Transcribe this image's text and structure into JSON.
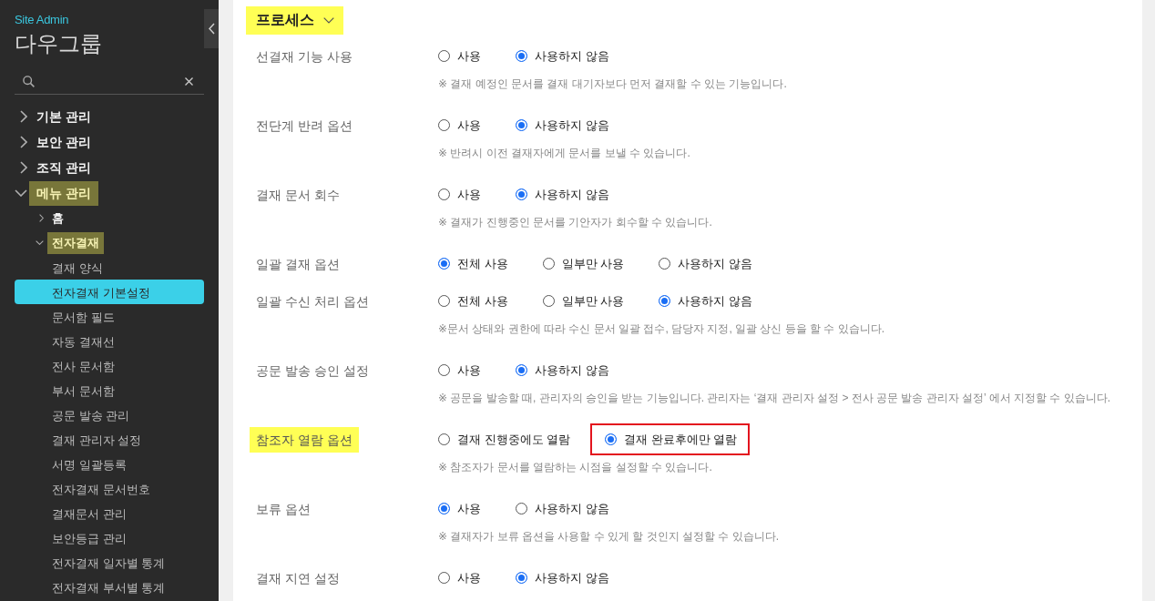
{
  "sidebar": {
    "subtitle": "Site Admin",
    "title": "다우그룹",
    "tree": [
      {
        "kind": "folder",
        "label": "기본 관리",
        "expanded": false,
        "highlighted": false,
        "selected": false
      },
      {
        "kind": "folder",
        "label": "보안 관리",
        "expanded": false,
        "highlighted": false,
        "selected": false
      },
      {
        "kind": "folder",
        "label": "조직 관리",
        "expanded": false,
        "highlighted": false,
        "selected": false
      },
      {
        "kind": "folder",
        "label": "메뉴 관리",
        "expanded": true,
        "highlighted": true,
        "selected": false,
        "children": [
          {
            "kind": "folder",
            "label": "홈",
            "expanded": false,
            "highlighted": false,
            "selected": false
          },
          {
            "kind": "folder",
            "label": "전자결재",
            "expanded": true,
            "highlighted": true,
            "selected": false,
            "children": [
              {
                "kind": "page",
                "label": "결재 양식",
                "highlighted": false,
                "selected": false
              },
              {
                "kind": "page",
                "label": "전자결재 기본설정",
                "highlighted": false,
                "selected": true
              },
              {
                "kind": "page",
                "label": "문서함 필드",
                "highlighted": false,
                "selected": false
              },
              {
                "kind": "page",
                "label": "자동 결재선",
                "highlighted": false,
                "selected": false
              },
              {
                "kind": "page",
                "label": "전사 문서함",
                "highlighted": false,
                "selected": false
              },
              {
                "kind": "page",
                "label": "부서 문서함",
                "highlighted": false,
                "selected": false
              },
              {
                "kind": "page",
                "label": "공문 발송 관리",
                "highlighted": false,
                "selected": false
              },
              {
                "kind": "page",
                "label": "결재 관리자 설정",
                "highlighted": false,
                "selected": false
              },
              {
                "kind": "page",
                "label": "서명 일괄등록",
                "highlighted": false,
                "selected": false
              },
              {
                "kind": "page",
                "label": "전자결재 문서번호",
                "highlighted": false,
                "selected": false
              },
              {
                "kind": "page",
                "label": "결재문서 관리",
                "highlighted": false,
                "selected": false
              },
              {
                "kind": "page",
                "label": "보안등급 관리",
                "highlighted": false,
                "selected": false
              },
              {
                "kind": "page",
                "label": "전자결재 일자별 통계",
                "highlighted": false,
                "selected": false
              },
              {
                "kind": "page",
                "label": "전자결재 부서별 통계",
                "highlighted": false,
                "selected": false
              }
            ]
          }
        ]
      }
    ]
  },
  "section": {
    "title": "프로세스",
    "highlighted": true,
    "expanded": true,
    "settings": [
      {
        "label": "선결재 기능 사용",
        "highlighted": false,
        "options": [
          {
            "label": "사용",
            "selected": false,
            "outlined": false
          },
          {
            "label": "사용하지 않음",
            "selected": true,
            "outlined": false
          }
        ],
        "note": "※ 결재 예정인 문서를 결재 대기자보다 먼저 결재할 수 있는 기능입니다."
      },
      {
        "label": "전단계 반려 옵션",
        "highlighted": false,
        "options": [
          {
            "label": "사용",
            "selected": false,
            "outlined": false
          },
          {
            "label": "사용하지 않음",
            "selected": true,
            "outlined": false
          }
        ],
        "note": "※ 반려시 이전 결재자에게 문서를 보낼 수 있습니다."
      },
      {
        "label": "결재 문서 회수",
        "highlighted": false,
        "options": [
          {
            "label": "사용",
            "selected": false,
            "outlined": false
          },
          {
            "label": "사용하지 않음",
            "selected": true,
            "outlined": false
          }
        ],
        "note": "※ 결재가 진행중인 문서를 기안자가 회수할 수 있습니다."
      },
      {
        "label": "일괄 결재 옵션",
        "highlighted": false,
        "options": [
          {
            "label": "전체 사용",
            "selected": true,
            "outlined": false
          },
          {
            "label": "일부만 사용",
            "selected": false,
            "outlined": false
          },
          {
            "label": "사용하지 않음",
            "selected": false,
            "outlined": false
          }
        ]
      },
      {
        "label": "일괄 수신 처리 옵션",
        "highlighted": false,
        "options": [
          {
            "label": "전체 사용",
            "selected": false,
            "outlined": false
          },
          {
            "label": "일부만 사용",
            "selected": false,
            "outlined": false
          },
          {
            "label": "사용하지 않음",
            "selected": true,
            "outlined": false
          }
        ],
        "note": "※문서 상태와 권한에 따라 수신 문서 일괄 접수, 담당자 지정, 일괄 상신 등을 할 수 있습니다."
      },
      {
        "label": "공문 발송 승인 설정",
        "highlighted": false,
        "options": [
          {
            "label": "사용",
            "selected": false,
            "outlined": false
          },
          {
            "label": "사용하지 않음",
            "selected": true,
            "outlined": false
          }
        ],
        "note": "※ 공문을 발송할 때, 관리자의 승인을 받는 기능입니다. 관리자는 ‘결재 관리자 설정 > 전사 공문 발송 관리자 설정’ 에서 지정할 수 있습니다."
      },
      {
        "label": "참조자 열람 옵션",
        "highlighted": true,
        "options": [
          {
            "label": "결재 진행중에도 열람",
            "selected": false,
            "outlined": false
          },
          {
            "label": "결재 완료후에만 열람",
            "selected": true,
            "outlined": true
          }
        ],
        "note": "※ 참조자가 문서를 열람하는 시점을 설정할 수 있습니다."
      },
      {
        "label": "보류 옵션",
        "highlighted": false,
        "options": [
          {
            "label": "사용",
            "selected": true,
            "outlined": false
          },
          {
            "label": "사용하지 않음",
            "selected": false,
            "outlined": false
          }
        ],
        "note": "※ 결재자가 보류 옵션을 사용할 수 있게 할 것인지 설정할 수 있습니다."
      },
      {
        "label": "결재 지연 설정",
        "highlighted": false,
        "options": [
          {
            "label": "사용",
            "selected": false,
            "outlined": false
          },
          {
            "label": "사용하지 않음",
            "selected": true,
            "outlined": false
          }
        ]
      }
    ]
  }
}
